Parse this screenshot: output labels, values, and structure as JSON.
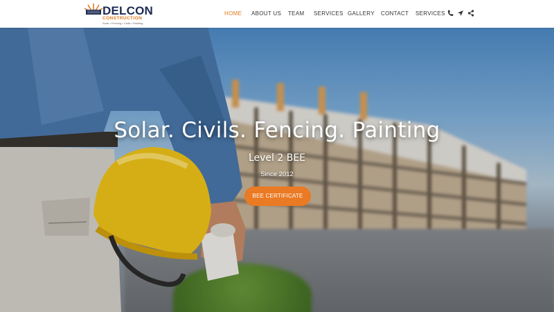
{
  "brand": {
    "name": "DELCON",
    "subname": "CONSTRUCTION",
    "tagline": "Solar • Fencing • Civils • Painting",
    "accent_color": "#e07a1f",
    "name_color": "#1d2a52"
  },
  "nav": {
    "items": [
      {
        "label": "HOME",
        "active": true
      },
      {
        "label": "ABOUT US",
        "active": false
      },
      {
        "label": "TEAM",
        "active": false
      },
      {
        "label": "SERVICES",
        "active": false
      },
      {
        "label": "GALLERY",
        "active": false
      },
      {
        "label": "CONTACT",
        "active": false
      },
      {
        "label": "SERVICES",
        "active": false
      }
    ],
    "icons": [
      "phone-icon",
      "location-arrow-icon",
      "share-icon"
    ]
  },
  "hero": {
    "title": "Solar. Civils. Fencing. Painting",
    "subtitle": "Level 2 BEE",
    "since": "Since 2012",
    "button_label": "BEE CERTIFICATE",
    "button_color": "#ea7a24"
  }
}
